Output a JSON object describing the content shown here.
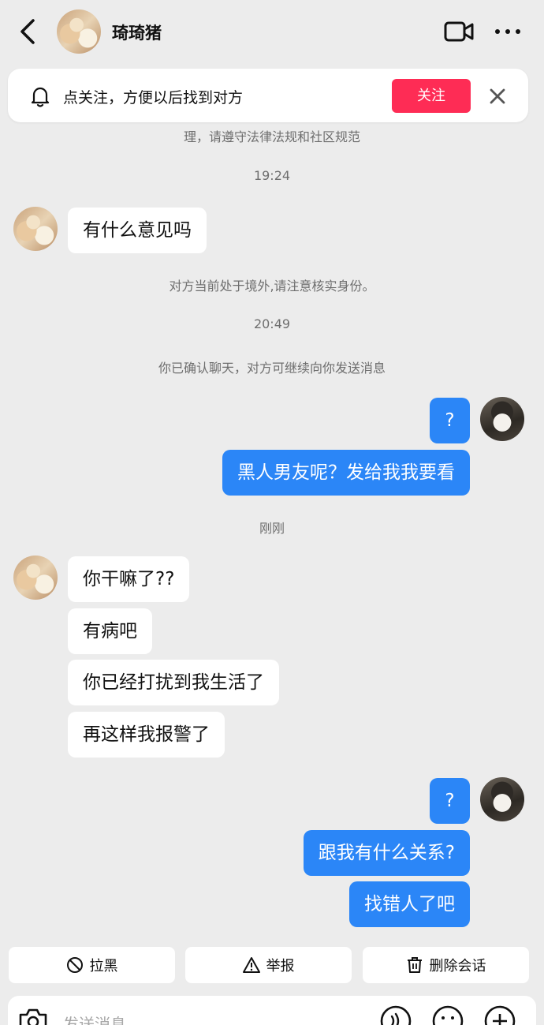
{
  "header": {
    "contact_name": "琦琦猪"
  },
  "banner": {
    "text": "点关注，方便以后找到对方",
    "follow_label": "关注"
  },
  "system": {
    "law_notice": "理，请遵守法律法规和社区规范",
    "abroad_notice": "对方当前处于境外,请注意核实身份。",
    "confirmed_notice": "你已确认聊天，对方可继续向你发送消息"
  },
  "timestamps": {
    "t1": "19:24",
    "t2": "20:49",
    "t3": "刚刚"
  },
  "messages": {
    "in1": "有什么意见吗",
    "out1": "?",
    "out2": "黑人男友呢？发给我我要看",
    "in2": "你干嘛了??",
    "in3": "有病吧",
    "in4": "你已经打扰到我生活了",
    "in5": "再这样我报警了",
    "out3": "?",
    "out4": "跟我有什么关系?",
    "out5": "找错人了吧"
  },
  "actions": {
    "block_label": "拉黑",
    "report_label": "举报",
    "delete_label": "删除会话"
  },
  "input": {
    "placeholder": "发送消息"
  },
  "colors": {
    "accent_red": "#fe2c55",
    "bubble_blue": "#2b86f7"
  }
}
